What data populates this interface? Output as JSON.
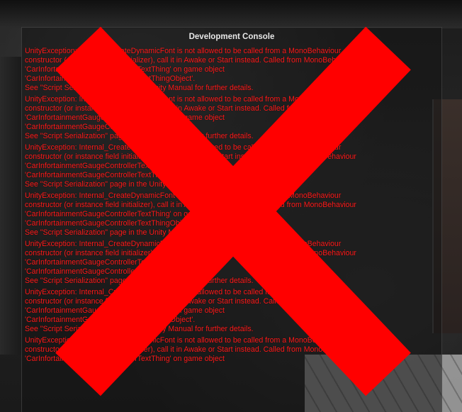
{
  "console": {
    "title": "Development Console",
    "entries": [
      {
        "lines": [
          "UnityException: Internal_CreateDynamicFont is not allowed to be called from a MonoBehaviour",
          "constructor (or instance field initializer), call it in Awake or Start instead. Called from MonoBehaviour",
          "'CarInfortainmentGaugeControllerTextThing' on game object",
          "'CarInfortainmentGaugeControllerTextThingObject'.",
          "See \"Script Serialization\" page in the Unity Manual for further details."
        ]
      },
      {
        "lines": [
          "UnityException: Internal_CreateDynamicFont is not allowed to be called from a MonoBehaviour",
          "constructor (or instance field initializer), call it in Awake or Start instead. Called from MonoBehaviour",
          "'CarInfortainmentGaugeControllerTextThing' on game object",
          "'CarInfortainmentGaugeControllerTextThingObject'.",
          "See \"Script Serialization\" page in the Unity Manual for further details."
        ]
      },
      {
        "lines": [
          "UnityException: Internal_CreateDynamicFont is not allowed to be called from a MonoBehaviour",
          "constructor (or instance field initializer), call it in Awake or Start instead. Called from MonoBehaviour",
          "'CarInfortainmentGaugeControllerTextThing' on game object",
          "'CarInfortainmentGaugeControllerTextThingObject'.",
          "See \"Script Serialization\" page in the Unity Manual for further details."
        ]
      },
      {
        "lines": [
          "UnityException: Internal_CreateDynamicFont is not allowed to be called from a MonoBehaviour",
          "constructor (or instance field initializer), call it in Awake or Start instead. Called from MonoBehaviour",
          "'CarInfortainmentGaugeControllerTextThing' on game object",
          "'CarInfortainmentGaugeControllerTextThingObject'.",
          "See \"Script Serialization\" page in the Unity Manual for further details."
        ]
      },
      {
        "lines": [
          "UnityException: Internal_CreateDynamicFont is not allowed to be called from a MonoBehaviour",
          "constructor (or instance field initializer), call it in Awake or Start instead. Called from MonoBehaviour",
          "'CarInfortainmentGaugeControllerTextThing' on game object",
          "'CarInfortainmentGaugeControllerTextThingObject'.",
          "See \"Script Serialization\" page in the Unity Manual for further details."
        ]
      },
      {
        "lines": [
          "UnityException: Internal_CreateDynamicFont is not allowed to be called from a MonoBehaviour",
          "constructor (or instance field initializer), call it in Awake or Start instead. Called from MonoBehaviour",
          "'CarInfortainmentGaugeControllerTextThing' on game object",
          "'CarInfortainmentGaugeControllerTextThingObject'.",
          "See \"Script Serialization\" page in the Unity Manual for further details."
        ]
      },
      {
        "lines": [
          "UnityException: Internal_CreateDynamicFont is not allowed to be called from a MonoBehaviour",
          "constructor (or instance field initializer), call it in Awake or Start instead. Called from MonoBehaviour",
          "'CarInfortainmentGaugeControllerTextThing' on game object"
        ]
      }
    ]
  },
  "colors": {
    "error_text": "#ff1a1a",
    "cross": "#ff0000",
    "title_text": "#e8e8e8"
  },
  "overlay": {
    "icon": "cross-mark-icon"
  }
}
